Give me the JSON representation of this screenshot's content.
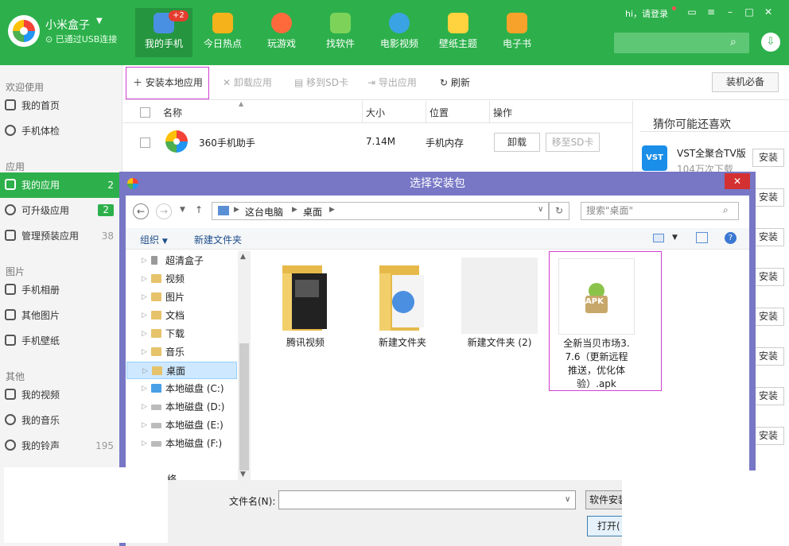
{
  "header": {
    "app_name": "小米盒子",
    "connection": "已通过USB连接",
    "login": "hi，请登录",
    "tabs": [
      {
        "label": "我的手机",
        "badge": "+2",
        "icon": "phone-icon",
        "color": "#4a90e2"
      },
      {
        "label": "今日热点",
        "icon": "star-icon",
        "color": "#f5b21b"
      },
      {
        "label": "玩游戏",
        "icon": "gamepad-icon",
        "color": "#ff6a3d"
      },
      {
        "label": "找软件",
        "icon": "android-icon",
        "color": "#7dd35a"
      },
      {
        "label": "电影视频",
        "icon": "play-icon",
        "color": "#3aa3e3"
      },
      {
        "label": "壁纸主题",
        "icon": "wallpaper-icon",
        "color": "#ffd23f"
      },
      {
        "label": "电子书",
        "icon": "book-icon",
        "color": "#f7a22a"
      }
    ]
  },
  "sidebar": {
    "groups": [
      {
        "title": "欢迎使用",
        "items": [
          {
            "label": "我的首页"
          },
          {
            "label": "手机体检"
          }
        ]
      },
      {
        "title": "应用",
        "items": [
          {
            "label": "我的应用",
            "count": "2",
            "active": true
          },
          {
            "label": "可升级应用",
            "count": "2",
            "green": true
          },
          {
            "label": "管理预装应用",
            "count": "38"
          }
        ]
      },
      {
        "title": "图片",
        "items": [
          {
            "label": "手机相册"
          },
          {
            "label": "其他图片"
          },
          {
            "label": "手机壁纸"
          }
        ]
      },
      {
        "title": "其他",
        "items": [
          {
            "label": "我的视频"
          },
          {
            "label": "我的音乐"
          },
          {
            "label": "我的铃声",
            "count": "195"
          }
        ]
      }
    ]
  },
  "toolbar": {
    "install_local": "安装本地应用",
    "uninstall": "卸载应用",
    "move_sd": "移到SD卡",
    "export": "导出应用",
    "refresh": "刷新",
    "must_have": "装机必备"
  },
  "table": {
    "headers": [
      "名称",
      "大小",
      "位置",
      "操作"
    ],
    "rows": [
      {
        "name": "360手机助手",
        "size": "7.14M",
        "location": "手机内存",
        "action1": "卸载",
        "action2": "移至SD卡"
      }
    ]
  },
  "recommend": {
    "title": "猜你可能还喜欢",
    "app": {
      "name": "VST全聚合TV版",
      "downloads": "104万次下载",
      "logo_text": "VST"
    },
    "install_label": "安装"
  },
  "dialog": {
    "title": "选择安装包",
    "path": [
      "这台电脑",
      "桌面"
    ],
    "search_placeholder": "搜索\"桌面\"",
    "organize": "组织",
    "new_folder": "新建文件夹",
    "tree": [
      "超清盒子",
      "视频",
      "图片",
      "文档",
      "下载",
      "音乐",
      "桌面",
      "本地磁盘 (C:)",
      "本地磁盘 (D:)",
      "本地磁盘 (E:)",
      "本地磁盘 (F:)"
    ],
    "tree_partial": "络",
    "files": [
      {
        "name": "腾讯视频"
      },
      {
        "name": "新建文件夹"
      },
      {
        "name": "新建文件夹 (2)"
      },
      {
        "name": "全新当贝市场3.7.6（更新远程推送，优化体验）.apk",
        "badge": "APK"
      }
    ],
    "filename_label": "文件名(N):",
    "filetype_button": "软件安装",
    "open_button": "打开("
  }
}
